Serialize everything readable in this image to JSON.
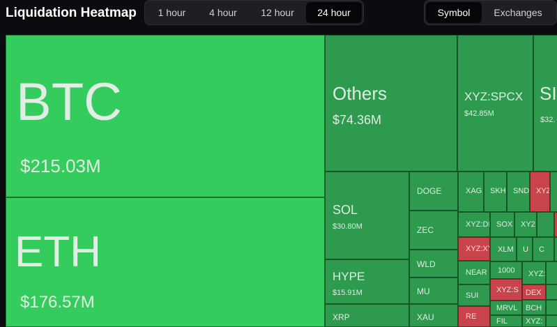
{
  "header": {
    "title": "Liquidation Heatmap",
    "timeframes": [
      "1 hour",
      "4 hour",
      "12 hour",
      "24 hour"
    ],
    "active_timeframe": "24 hour",
    "views": [
      "Symbol",
      "Exchanges"
    ],
    "active_view": "Symbol"
  },
  "colors": {
    "large_long": "#34cc5c",
    "long": "#2d9a4e",
    "short": "#c8444a",
    "background": "#0b0b10"
  },
  "heatmap": {
    "btc": {
      "symbol": "BTC",
      "value": "$215.03M"
    },
    "eth": {
      "symbol": "ETH",
      "value": "$176.57M"
    },
    "others": {
      "symbol": "Others",
      "value": "$74.36M"
    },
    "spcx": {
      "symbol": "XYZ:SPCX",
      "value": "$42.85M"
    },
    "cut1": {
      "symbol": "SI",
      "value": "$32."
    },
    "sol": {
      "symbol": "SOL",
      "value": "$30.80M"
    },
    "hype": {
      "symbol": "HYPE",
      "value": "$15.91M"
    },
    "xrp": {
      "symbol": "XRP"
    },
    "doge": {
      "symbol": "DOGE"
    },
    "zec": {
      "symbol": "ZEC"
    },
    "wld": {
      "symbol": "WLD"
    },
    "mu": {
      "symbol": "MU"
    },
    "xau": {
      "symbol": "XAU"
    },
    "xag": {
      "symbol": "XAG"
    },
    "skh": {
      "symbol": "SKH"
    },
    "snd": {
      "symbol": "SND"
    },
    "xyz1": {
      "symbol": "XYZ"
    },
    "xyzdi": {
      "symbol": "XYZ:DI"
    },
    "sox": {
      "symbol": "SOX"
    },
    "xy2": {
      "symbol": "XY2"
    },
    "xyzxy": {
      "symbol": "XYZ:XY"
    },
    "xlm": {
      "symbol": "XLM"
    },
    "u": {
      "symbol": "U"
    },
    "c": {
      "symbol": "C"
    },
    "near": {
      "symbol": "NEAR"
    },
    "k1000": {
      "symbol": "1000"
    },
    "xyzc": {
      "symbol": "XYZ:"
    },
    "sui": {
      "symbol": "SUI"
    },
    "xyzs": {
      "symbol": "XYZ:S"
    },
    "dex": {
      "symbol": "DEX"
    },
    "mrvl": {
      "symbol": "MRVL"
    },
    "bch": {
      "symbol": "BCH"
    },
    "re": {
      "symbol": "RE"
    },
    "fil": {
      "symbol": "FIL"
    },
    "xyzd": {
      "symbol": "XYZ:"
    }
  }
}
